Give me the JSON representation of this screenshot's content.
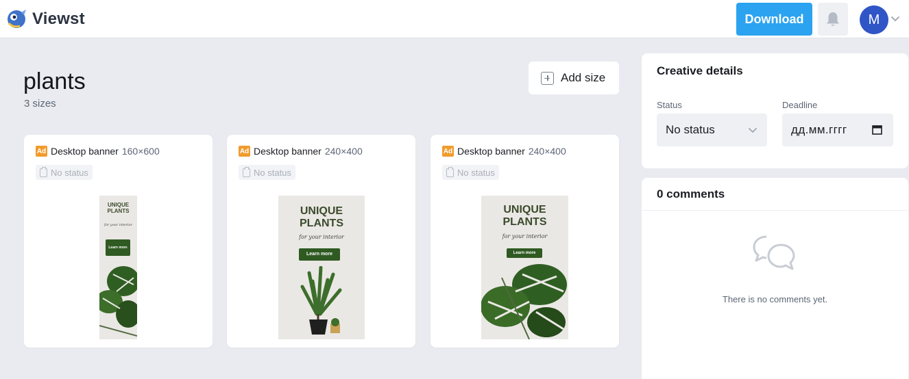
{
  "app": {
    "name": "Viewst"
  },
  "header": {
    "download_label": "Download",
    "avatar_initial": "M"
  },
  "project": {
    "title": "plants",
    "subtitle": "3 sizes",
    "add_size_label": "Add size"
  },
  "creatives": [
    {
      "badge": "Ad",
      "name": "Desktop banner",
      "size": "160×600",
      "status": "No status",
      "banner": {
        "headline": "UNIQUE\nPLANTS",
        "tagline": "for your interior",
        "cta": "Learn more"
      }
    },
    {
      "badge": "Ad",
      "name": "Desktop banner",
      "size": "240×400",
      "status": "No status",
      "banner": {
        "headline": "UNIQUE\nPLANTS",
        "tagline": "for your interior",
        "cta": "Learn more"
      }
    },
    {
      "badge": "Ad",
      "name": "Desktop banner",
      "size": "240×400",
      "status": "No status",
      "banner": {
        "headline": "UNIQUE\nPLANTS",
        "tagline": "for your interior",
        "cta": "Learn more"
      }
    }
  ],
  "details": {
    "title": "Creative details",
    "status_label": "Status",
    "status_value": "No status",
    "deadline_label": "Deadline",
    "deadline_placeholder": "дд.мм.гггг"
  },
  "comments": {
    "title": "0 comments",
    "empty_text": "There is no comments yet."
  },
  "colors": {
    "accent": "#2ba3f0",
    "avatar": "#2f55c7",
    "ad_badge": "#f19b2d",
    "cta": "#2f5a22"
  }
}
